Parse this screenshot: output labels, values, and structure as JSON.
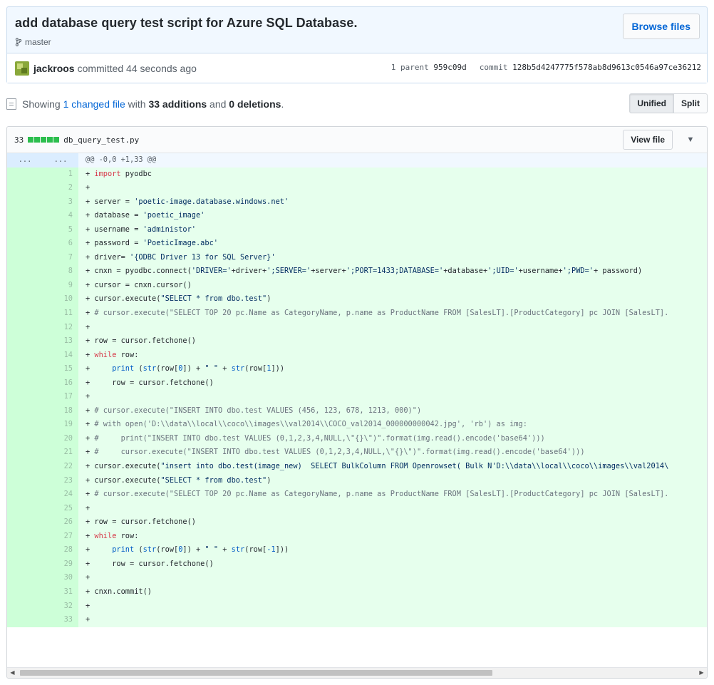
{
  "commit": {
    "title": "add database query test script for Azure SQL Database.",
    "branch": "master",
    "browse_label": "Browse files",
    "author": "jackroos",
    "committed_text": "committed 44 seconds ago",
    "parent_label": "1 parent",
    "parent_sha": "959c09d",
    "commit_label": "commit",
    "commit_sha": "128b5d4247775f578ab8d9613c0546a97ce36212"
  },
  "toc": {
    "showing": "Showing",
    "changed_files": "1 changed file",
    "with": "with",
    "additions": "33 additions",
    "and": "and",
    "deletions": "0 deletions",
    "period": ".",
    "unified_label": "Unified",
    "split_label": "Split"
  },
  "file": {
    "diffstat": "33",
    "name": "db_query_test.py",
    "view_file_label": "View file",
    "hunk_dots_old": "...",
    "hunk_dots_new": "...",
    "hunk_header": "@@ -0,0 +1,33 @@",
    "lines": [
      {
        "n": "1",
        "tokens": [
          [
            "+ ",
            "plain"
          ],
          [
            "import",
            "kw"
          ],
          [
            " pyodbc",
            "plain"
          ]
        ]
      },
      {
        "n": "2",
        "tokens": [
          [
            "+",
            "plain"
          ]
        ]
      },
      {
        "n": "3",
        "tokens": [
          [
            "+ server = ",
            "plain"
          ],
          [
            "'poetic-image.database.windows.net'",
            "str"
          ]
        ]
      },
      {
        "n": "4",
        "tokens": [
          [
            "+ database = ",
            "plain"
          ],
          [
            "'poetic_image'",
            "str"
          ]
        ]
      },
      {
        "n": "5",
        "tokens": [
          [
            "+ username = ",
            "plain"
          ],
          [
            "'administor'",
            "str"
          ]
        ]
      },
      {
        "n": "6",
        "tokens": [
          [
            "+ password = ",
            "plain"
          ],
          [
            "'PoeticImage.abc'",
            "str"
          ]
        ]
      },
      {
        "n": "7",
        "tokens": [
          [
            "+ driver= ",
            "plain"
          ],
          [
            "'{ODBC Driver 13 for SQL Server}'",
            "str"
          ]
        ]
      },
      {
        "n": "8",
        "tokens": [
          [
            "+ cnxn = pyodbc.connect(",
            "plain"
          ],
          [
            "'DRIVER='",
            "str"
          ],
          [
            "+driver+",
            "plain"
          ],
          [
            "';SERVER='",
            "str"
          ],
          [
            "+server+",
            "plain"
          ],
          [
            "';PORT=1433;DATABASE='",
            "str"
          ],
          [
            "+database+",
            "plain"
          ],
          [
            "';UID='",
            "str"
          ],
          [
            "+username+",
            "plain"
          ],
          [
            "';PWD='",
            "str"
          ],
          [
            "+ password)",
            "plain"
          ]
        ]
      },
      {
        "n": "9",
        "tokens": [
          [
            "+ cursor = cnxn.cursor()",
            "plain"
          ]
        ]
      },
      {
        "n": "10",
        "tokens": [
          [
            "+ cursor.execute(",
            "plain"
          ],
          [
            "\"SELECT * from dbo.test\"",
            "str"
          ],
          [
            ")",
            "plain"
          ]
        ]
      },
      {
        "n": "11",
        "tokens": [
          [
            "+ ",
            "plain"
          ],
          [
            "# cursor.execute(\"SELECT TOP 20 pc.Name as CategoryName, p.name as ProductName FROM [SalesLT].[ProductCategory] pc JOIN [SalesLT].",
            "com"
          ]
        ]
      },
      {
        "n": "12",
        "tokens": [
          [
            "+",
            "plain"
          ]
        ]
      },
      {
        "n": "13",
        "tokens": [
          [
            "+ row = cursor.fetchone()",
            "plain"
          ]
        ]
      },
      {
        "n": "14",
        "tokens": [
          [
            "+ ",
            "plain"
          ],
          [
            "while",
            "kw"
          ],
          [
            " row:",
            "plain"
          ]
        ]
      },
      {
        "n": "15",
        "tokens": [
          [
            "+     ",
            "plain"
          ],
          [
            "print",
            "fn"
          ],
          [
            " (",
            "plain"
          ],
          [
            "str",
            "fn"
          ],
          [
            "(row[",
            "plain"
          ],
          [
            "0",
            "fn"
          ],
          [
            "]) + ",
            "plain"
          ],
          [
            "\" \"",
            "str"
          ],
          [
            " + ",
            "plain"
          ],
          [
            "str",
            "fn"
          ],
          [
            "(row[",
            "plain"
          ],
          [
            "1",
            "fn"
          ],
          [
            "]))",
            "plain"
          ]
        ]
      },
      {
        "n": "16",
        "tokens": [
          [
            "+     row = cursor.fetchone()",
            "plain"
          ]
        ]
      },
      {
        "n": "17",
        "tokens": [
          [
            "+",
            "plain"
          ]
        ]
      },
      {
        "n": "18",
        "tokens": [
          [
            "+ ",
            "plain"
          ],
          [
            "# cursor.execute(\"INSERT INTO dbo.test VALUES (456, 123, 678, 1213, 000)\")",
            "com"
          ]
        ]
      },
      {
        "n": "19",
        "tokens": [
          [
            "+ ",
            "plain"
          ],
          [
            "# with open('D:\\\\data\\\\local\\\\coco\\\\images\\\\val2014\\\\COCO_val2014_000000000042.jpg', 'rb') as img:",
            "com"
          ]
        ]
      },
      {
        "n": "20",
        "tokens": [
          [
            "+ ",
            "plain"
          ],
          [
            "#     print(\"INSERT INTO dbo.test VALUES (0,1,2,3,4,NULL,\\\"{}\\\")\".format(img.read().encode('base64')))",
            "com"
          ]
        ]
      },
      {
        "n": "21",
        "tokens": [
          [
            "+ ",
            "plain"
          ],
          [
            "#     cursor.execute(\"INSERT INTO dbo.test VALUES (0,1,2,3,4,NULL,\\\"{}\\\")\".format(img.read().encode('base64')))",
            "com"
          ]
        ]
      },
      {
        "n": "22",
        "tokens": [
          [
            "+ cursor.execute(",
            "plain"
          ],
          [
            "\"insert into dbo.test(image_new)  SELECT BulkColumn FROM Openrowset( Bulk N'D:\\\\data\\\\local\\\\coco\\\\images\\\\val2014\\",
            "str"
          ]
        ]
      },
      {
        "n": "23",
        "tokens": [
          [
            "+ cursor.execute(",
            "plain"
          ],
          [
            "\"SELECT * from dbo.test\"",
            "str"
          ],
          [
            ")",
            "plain"
          ]
        ]
      },
      {
        "n": "24",
        "tokens": [
          [
            "+ ",
            "plain"
          ],
          [
            "# cursor.execute(\"SELECT TOP 20 pc.Name as CategoryName, p.name as ProductName FROM [SalesLT].[ProductCategory] pc JOIN [SalesLT].",
            "com"
          ]
        ]
      },
      {
        "n": "25",
        "tokens": [
          [
            "+",
            "plain"
          ]
        ]
      },
      {
        "n": "26",
        "tokens": [
          [
            "+ row = cursor.fetchone()",
            "plain"
          ]
        ]
      },
      {
        "n": "27",
        "tokens": [
          [
            "+ ",
            "plain"
          ],
          [
            "while",
            "kw"
          ],
          [
            " row:",
            "plain"
          ]
        ]
      },
      {
        "n": "28",
        "tokens": [
          [
            "+     ",
            "plain"
          ],
          [
            "print",
            "fn"
          ],
          [
            " (",
            "plain"
          ],
          [
            "str",
            "fn"
          ],
          [
            "(row[",
            "plain"
          ],
          [
            "0",
            "fn"
          ],
          [
            "]) + ",
            "plain"
          ],
          [
            "\" \"",
            "str"
          ],
          [
            " + ",
            "plain"
          ],
          [
            "str",
            "fn"
          ],
          [
            "(row[",
            "plain"
          ],
          [
            "-1",
            "fn"
          ],
          [
            "]))",
            "plain"
          ]
        ]
      },
      {
        "n": "29",
        "tokens": [
          [
            "+     row = cursor.fetchone()",
            "plain"
          ]
        ]
      },
      {
        "n": "30",
        "tokens": [
          [
            "+",
            "plain"
          ]
        ]
      },
      {
        "n": "31",
        "tokens": [
          [
            "+ cnxn.commit()",
            "plain"
          ]
        ]
      },
      {
        "n": "32",
        "tokens": [
          [
            "+",
            "plain"
          ]
        ]
      },
      {
        "n": "33",
        "tokens": [
          [
            "+",
            "plain"
          ]
        ]
      }
    ]
  },
  "icons": {
    "branch": "git-branch-icon",
    "file": "file-diff-icon",
    "collapse": "chevron-down-icon",
    "scroll_left": "scroll-left-arrow",
    "scroll_right": "scroll-right-arrow"
  },
  "colors": {
    "addition_bg": "#e6ffed",
    "addition_num_bg": "#cdffd8",
    "diffstat_block": "#2cbe4e",
    "link": "#0366d6"
  }
}
